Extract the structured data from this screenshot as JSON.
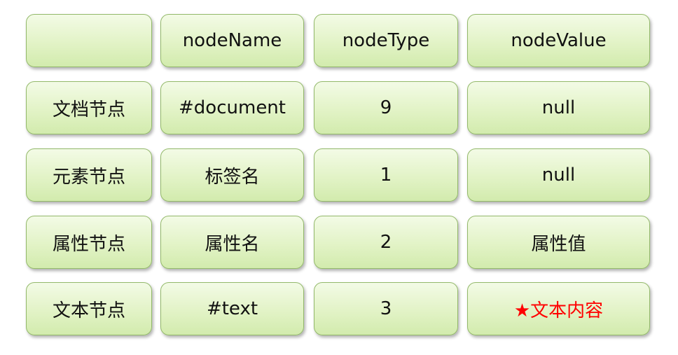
{
  "table": {
    "header": [
      "",
      "nodeName",
      "nodeType",
      "nodeValue"
    ],
    "rows": [
      [
        "文档节点",
        "#document",
        "9",
        "null"
      ],
      [
        "元素节点",
        "标签名",
        "1",
        "null"
      ],
      [
        "属性节点",
        "属性名",
        "2",
        "属性值"
      ],
      [
        "文本节点",
        "#text",
        "3",
        "★文本内容"
      ]
    ]
  },
  "colors": {
    "cell_fill": "#e2f3c6",
    "cell_border": "#93b96a",
    "highlight_text": "#ff0000"
  }
}
